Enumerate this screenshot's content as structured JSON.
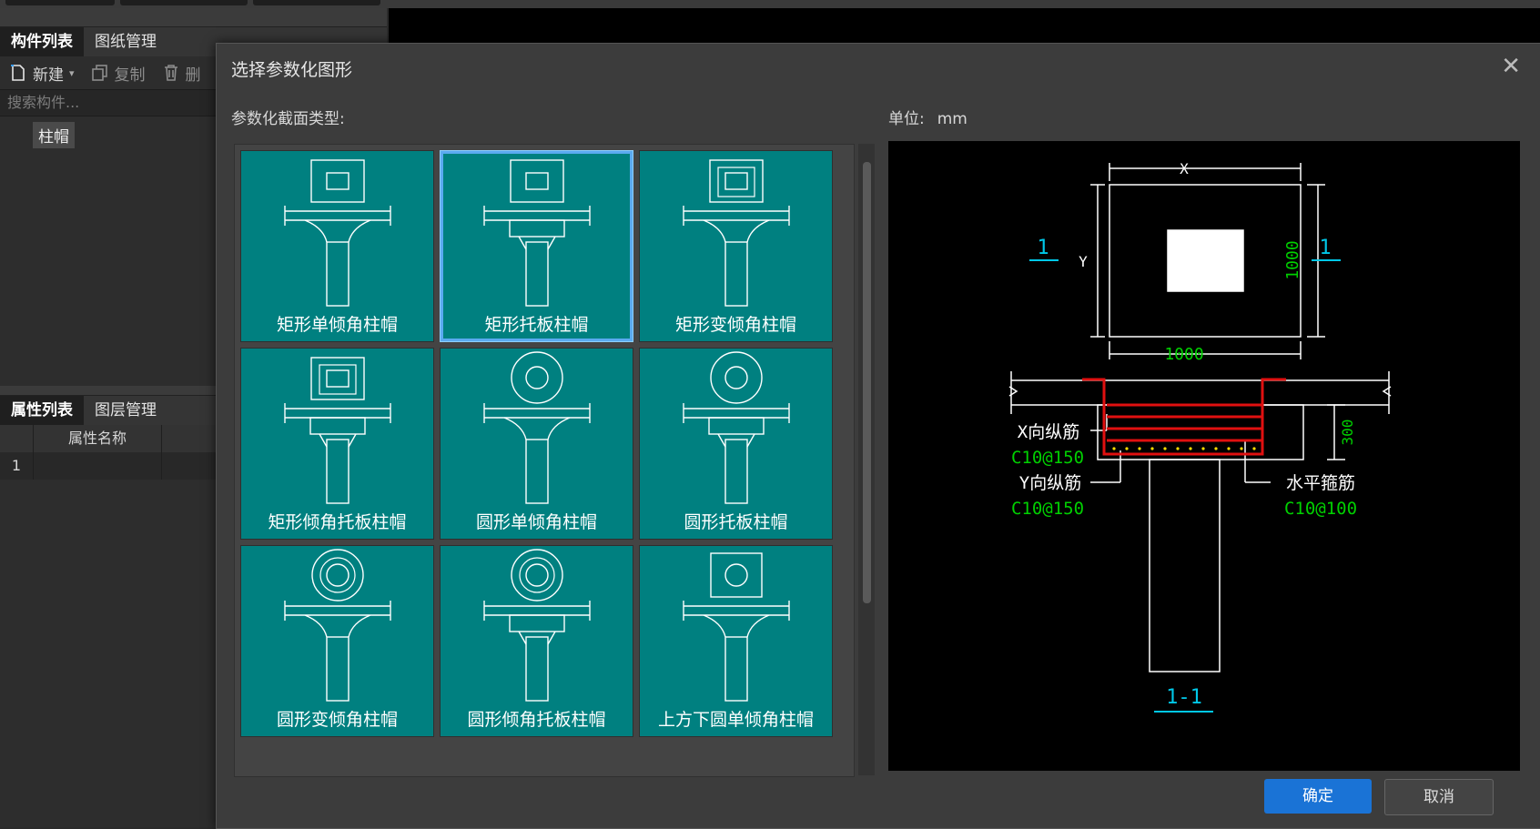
{
  "left_panel": {
    "tabs": [
      "构件列表",
      "图纸管理"
    ],
    "toolbar": {
      "new": "新建",
      "copy": "复制",
      "delete": "删"
    },
    "search_placeholder": "搜索构件...",
    "tree_item": "柱帽",
    "property_tabs": [
      "属性列表",
      "图层管理"
    ],
    "property_header": "属性名称",
    "property_row_number": "1"
  },
  "dialog": {
    "title": "选择参数化图形",
    "section_type_label": "参数化截面类型:",
    "unit_label": "单位:",
    "unit_value": "mm",
    "ok": "确定",
    "cancel": "取消",
    "selected_index": 1,
    "shapes": [
      {
        "name": "矩形单倾角柱帽",
        "head": "rect"
      },
      {
        "name": "矩形托板柱帽",
        "head": "rect"
      },
      {
        "name": "矩形变倾角柱帽",
        "head": "rect2"
      },
      {
        "name": "矩形倾角托板柱帽",
        "head": "rect2"
      },
      {
        "name": "圆形单倾角柱帽",
        "head": "circle"
      },
      {
        "name": "圆形托板柱帽",
        "head": "circle"
      },
      {
        "name": "圆形变倾角柱帽",
        "head": "circle2"
      },
      {
        "name": "圆形倾角托板柱帽",
        "head": "circle2"
      },
      {
        "name": "上方下圆单倾角柱帽",
        "head": "squarecircle"
      }
    ]
  },
  "preview": {
    "dim_x": "X",
    "dim_y": "Y",
    "dim_width": "1000",
    "dim_height": "1000",
    "section_mark": "1",
    "section_title": "1-1",
    "dim_depth": "300",
    "x_rebar_label": "X向纵筋",
    "x_rebar_value": "C10@150",
    "y_rebar_label": "Y向纵筋",
    "y_rebar_value": "C10@150",
    "stirrup_label": "水平箍筋",
    "stirrup_value": "C10@100"
  },
  "colors": {
    "cell_teal": "#008080",
    "primary_button": "#1a73d6",
    "dim_green": "#00d000",
    "section_cyan": "#00c8e8",
    "rebar_red": "#e01010"
  }
}
